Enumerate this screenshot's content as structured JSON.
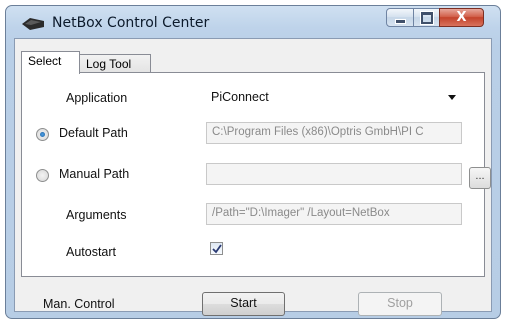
{
  "window": {
    "title": "NetBox Control Center",
    "close_glyph": "X",
    "icons": {
      "app": "netbox-app-icon",
      "minimize": "minimize-icon",
      "maximize": "maximize-icon",
      "close": "close-icon"
    }
  },
  "tabs": [
    {
      "label": "Select",
      "active": true
    },
    {
      "label": "Log Tool",
      "active": false
    }
  ],
  "form": {
    "application": {
      "label": "Application",
      "value": "PiConnect",
      "icon": "chevron-down-icon"
    },
    "default_path": {
      "label": "Default Path",
      "selected": true,
      "value": "C:\\Program Files (x86)\\Optris GmbH\\PI C"
    },
    "manual_path": {
      "label": "Manual Path",
      "selected": false,
      "value": "",
      "browse_label": "..."
    },
    "arguments": {
      "label": "Arguments",
      "value": "/Path=\"D:\\Imager\" /Layout=NetBox"
    },
    "autostart": {
      "label": "Autostart",
      "checked": true
    }
  },
  "footer": {
    "label": "Man. Control",
    "start_label": "Start",
    "stop_label": "Stop",
    "stop_enabled": false
  },
  "colors": {
    "accent": "#1c5d9e",
    "title_bar": "#bed3ea",
    "close_button": "#c3422b"
  }
}
